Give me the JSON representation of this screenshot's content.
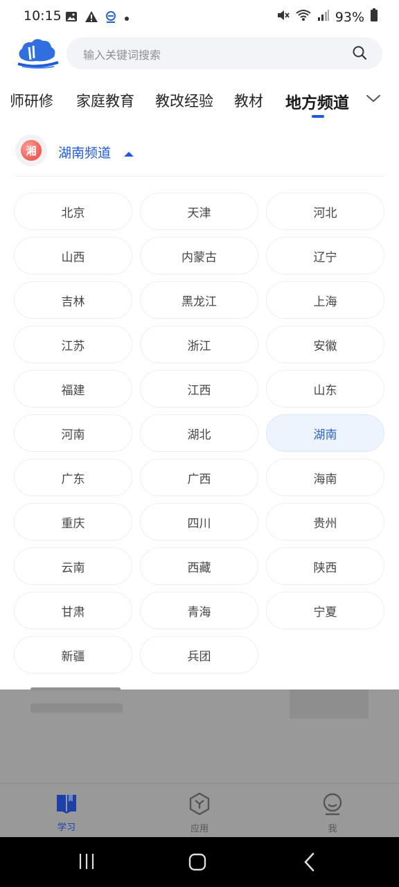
{
  "status_bar": {
    "time": "10:15",
    "battery": "93%",
    "left_icons": [
      "image-icon",
      "warning-icon",
      "app-notification-icon",
      "dot-icon"
    ],
    "right_icons": [
      "mute-icon",
      "wifi-icon",
      "signal-icon",
      "battery-icon"
    ]
  },
  "header": {
    "search_placeholder": "输入关键词搜索"
  },
  "tabs": {
    "items": [
      "师研修",
      "家庭教育",
      "教改经验",
      "教材",
      "地方频道"
    ],
    "active": "地方频道"
  },
  "channel": {
    "badge_char": "湘",
    "title": "湖南频道"
  },
  "provinces": [
    "北京",
    "天津",
    "河北",
    "山西",
    "内蒙古",
    "辽宁",
    "吉林",
    "黑龙江",
    "上海",
    "江苏",
    "浙江",
    "安徽",
    "福建",
    "江西",
    "山东",
    "河南",
    "湖北",
    "湖南",
    "广东",
    "广西",
    "海南",
    "重庆",
    "四川",
    "贵州",
    "云南",
    "西藏",
    "陕西",
    "甘肃",
    "青海",
    "宁夏",
    "新疆",
    "兵团"
  ],
  "selected_province": "湖南",
  "bottom_nav": {
    "items": [
      {
        "label": "学习",
        "icon": "book-icon",
        "active": true
      },
      {
        "label": "应用",
        "icon": "apps-hexagon-icon",
        "active": false
      },
      {
        "label": "我",
        "icon": "profile-icon",
        "active": false
      }
    ]
  },
  "colors": {
    "accent": "#1f5ad8",
    "selected_bg": "#eef4fd",
    "overlay": "#999999"
  }
}
